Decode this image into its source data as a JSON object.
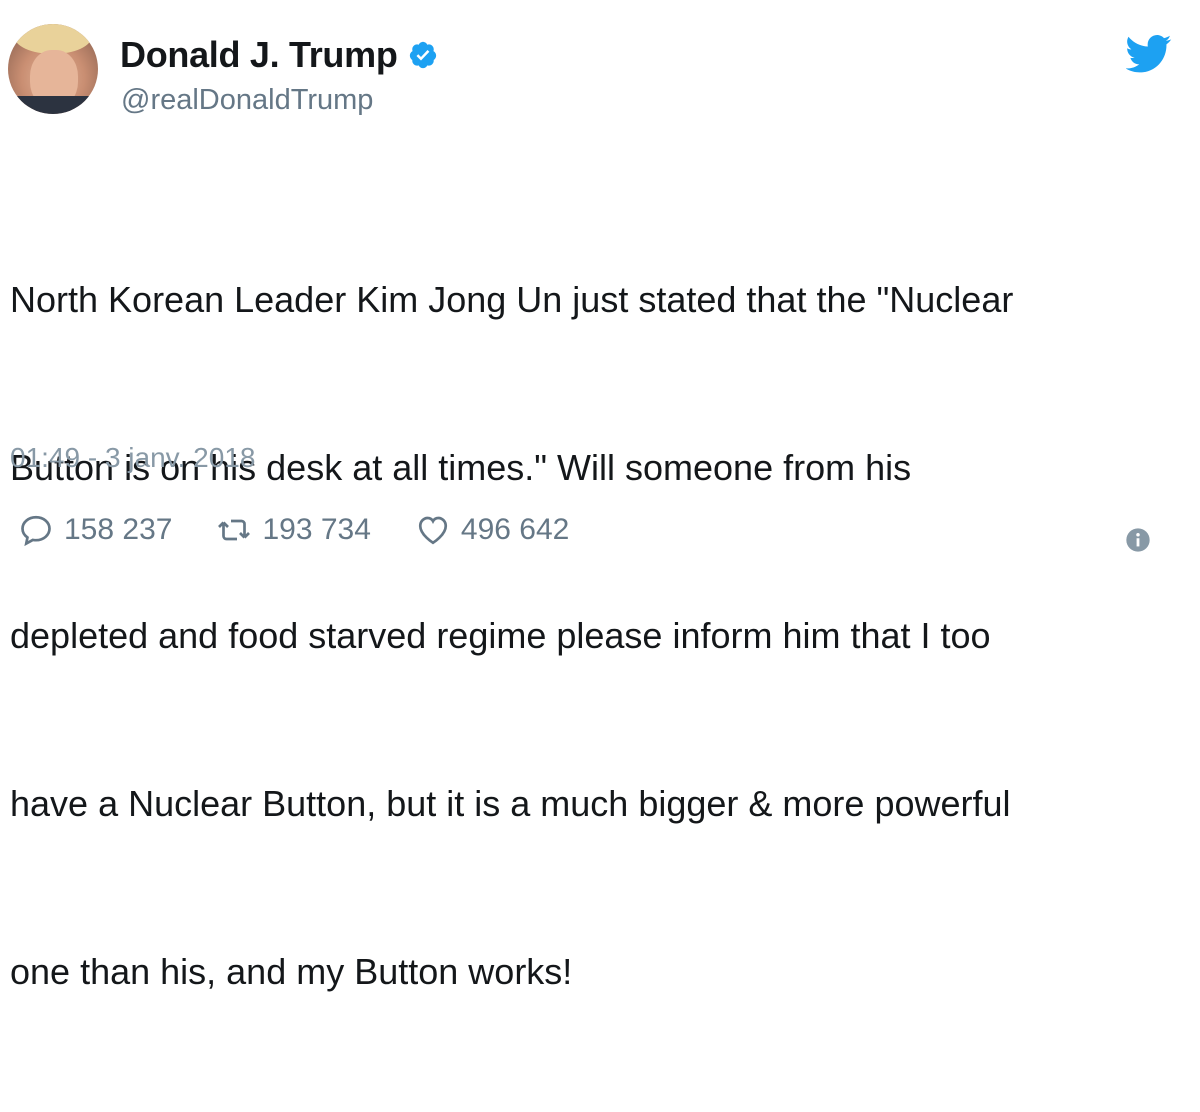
{
  "author": {
    "display_name": "Donald J. Trump",
    "handle": "@realDonaldTrump",
    "verified": true,
    "avatar_icon": "profile-photo"
  },
  "tweet": {
    "text_lines": [
      "North Korean Leader Kim Jong Un just stated that the \"Nuclear",
      "Button is on his desk at all times.\" Will someone from his",
      "depleted and food starved regime please inform him that I too",
      "have a Nuclear Button, but it is a much bigger & more powerful",
      "one than his, and my Button works!"
    ],
    "timestamp": "01:49 - 3 janv. 2018"
  },
  "stats": {
    "replies": "158 237",
    "retweets": "193 734",
    "likes": "496 642"
  },
  "icons": {
    "brand": "twitter-bird-icon",
    "verified": "verified-badge-icon",
    "reply": "reply-icon",
    "retweet": "retweet-icon",
    "like": "heart-icon",
    "info": "info-icon"
  },
  "colors": {
    "brand_blue": "#1da1f2",
    "text": "#14171a",
    "secondary": "#657786",
    "timestamp": "#8899a6"
  }
}
